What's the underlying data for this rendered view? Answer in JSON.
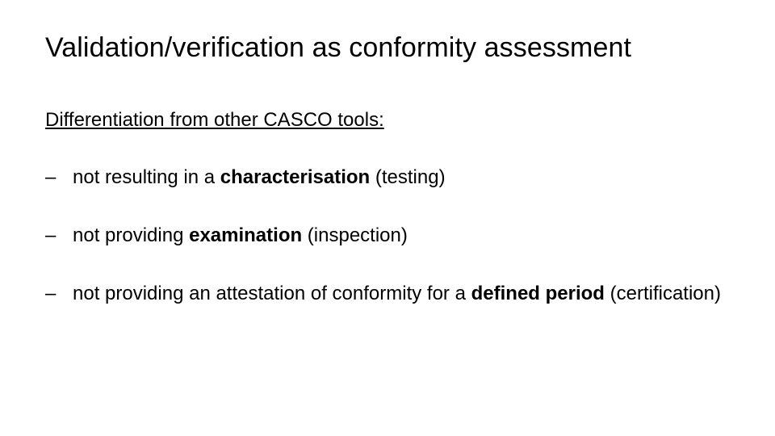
{
  "title": "Validation/verification as conformity assessment",
  "subtitle": "Differentiation from other CASCO tools:",
  "bullets": [
    {
      "pre": "not resulting in a ",
      "bold": "characterisation",
      "post": " (testing)"
    },
    {
      "pre": "not providing ",
      "bold": "examination",
      "post": " (inspection)"
    },
    {
      "pre": "not providing an attestation of conformity for a ",
      "bold": "defined period",
      "post": " (certification)"
    }
  ]
}
